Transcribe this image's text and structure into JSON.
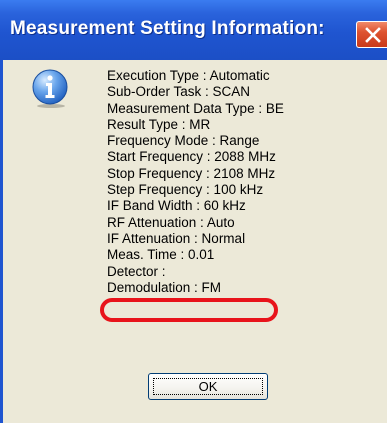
{
  "window": {
    "title": "Measurement Setting Information:",
    "close_icon": "close-icon"
  },
  "dialog": {
    "icon": "info-icon",
    "lines": [
      "Execution Type : Automatic",
      "Sub-Order Task : SCAN",
      "Measurement Data Type : BE",
      "Result Type : MR",
      "Frequency Mode : Range",
      "Start Frequency : 2088 MHz",
      "Stop Frequency : 2108 MHz",
      "Step Frequency : 100 kHz",
      "IF Band Width : 60 kHz",
      "RF Attenuation : Auto",
      "IF Attenuation : Normal",
      "Meas. Time : 0.01",
      "Detector :",
      "Demodulation : FM"
    ],
    "highlight_color": "#e8141b",
    "ok_label": "OK"
  },
  "colors": {
    "titlebar": "#1f55d0",
    "dialog_background": "#ece9d8",
    "close_button": "#de5330"
  }
}
